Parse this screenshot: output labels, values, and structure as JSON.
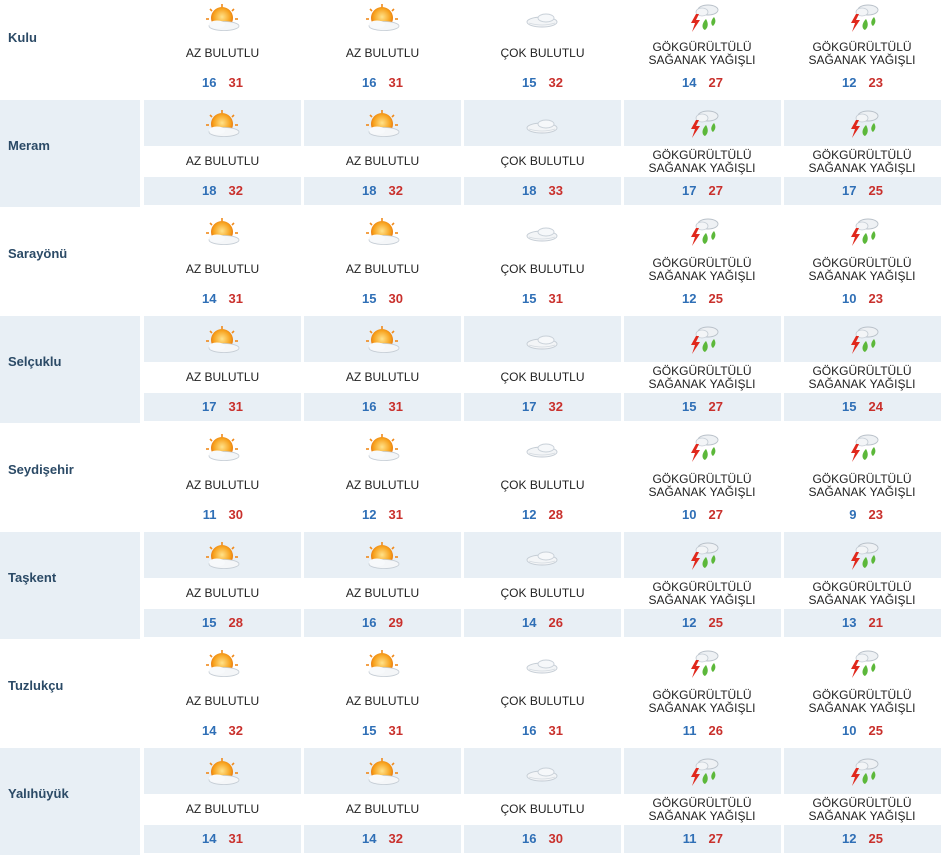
{
  "colors": {
    "shade": "#e8eff5",
    "sidebar": "#e8eff5",
    "separator": "#ffffff",
    "min_temp": "#2f6fb6",
    "max_temp": "#c9302c",
    "district_name": "#2b4a66"
  },
  "districts": [
    {
      "name": "Kulu",
      "days": [
        {
          "icon": "sun-cloud-icon",
          "condition": "AZ BULUTLU",
          "min": "16",
          "max": "31"
        },
        {
          "icon": "sun-cloud-icon",
          "condition": "AZ BULUTLU",
          "min": "16",
          "max": "31"
        },
        {
          "icon": "cloud-icon",
          "condition": "ÇOK BULUTLU",
          "min": "15",
          "max": "32"
        },
        {
          "icon": "thunderstorm-icon",
          "condition": "GÖKGÜRÜLTÜLÜ SAĞANAK YAĞIŞLI",
          "min": "14",
          "max": "27"
        },
        {
          "icon": "thunderstorm-icon",
          "condition": "GÖKGÜRÜLTÜLÜ SAĞANAK YAĞIŞLI",
          "min": "12",
          "max": "23"
        }
      ]
    },
    {
      "name": "Meram",
      "days": [
        {
          "icon": "sun-cloud-icon",
          "condition": "AZ BULUTLU",
          "min": "18",
          "max": "32"
        },
        {
          "icon": "sun-cloud-icon",
          "condition": "AZ BULUTLU",
          "min": "18",
          "max": "32"
        },
        {
          "icon": "cloud-icon",
          "condition": "ÇOK BULUTLU",
          "min": "18",
          "max": "33"
        },
        {
          "icon": "thunderstorm-icon",
          "condition": "GÖKGÜRÜLTÜLÜ SAĞANAK YAĞIŞLI",
          "min": "17",
          "max": "27"
        },
        {
          "icon": "thunderstorm-icon",
          "condition": "GÖKGÜRÜLTÜLÜ SAĞANAK YAĞIŞLI",
          "min": "17",
          "max": "25"
        }
      ]
    },
    {
      "name": "Sarayönü",
      "days": [
        {
          "icon": "sun-cloud-icon",
          "condition": "AZ BULUTLU",
          "min": "14",
          "max": "31"
        },
        {
          "icon": "sun-cloud-icon",
          "condition": "AZ BULUTLU",
          "min": "15",
          "max": "30"
        },
        {
          "icon": "cloud-icon",
          "condition": "ÇOK BULUTLU",
          "min": "15",
          "max": "31"
        },
        {
          "icon": "thunderstorm-icon",
          "condition": "GÖKGÜRÜLTÜLÜ SAĞANAK YAĞIŞLI",
          "min": "12",
          "max": "25"
        },
        {
          "icon": "thunderstorm-icon",
          "condition": "GÖKGÜRÜLTÜLÜ SAĞANAK YAĞIŞLI",
          "min": "10",
          "max": "23"
        }
      ]
    },
    {
      "name": "Selçuklu",
      "days": [
        {
          "icon": "sun-cloud-icon",
          "condition": "AZ BULUTLU",
          "min": "17",
          "max": "31"
        },
        {
          "icon": "sun-cloud-icon",
          "condition": "AZ BULUTLU",
          "min": "16",
          "max": "31"
        },
        {
          "icon": "cloud-icon",
          "condition": "ÇOK BULUTLU",
          "min": "17",
          "max": "32"
        },
        {
          "icon": "thunderstorm-icon",
          "condition": "GÖKGÜRÜLTÜLÜ SAĞANAK YAĞIŞLI",
          "min": "15",
          "max": "27"
        },
        {
          "icon": "thunderstorm-icon",
          "condition": "GÖKGÜRÜLTÜLÜ SAĞANAK YAĞIŞLI",
          "min": "15",
          "max": "24"
        }
      ]
    },
    {
      "name": "Seydişehir",
      "days": [
        {
          "icon": "sun-cloud-icon",
          "condition": "AZ BULUTLU",
          "min": "11",
          "max": "30"
        },
        {
          "icon": "sun-cloud-icon",
          "condition": "AZ BULUTLU",
          "min": "12",
          "max": "31"
        },
        {
          "icon": "cloud-icon",
          "condition": "ÇOK BULUTLU",
          "min": "12",
          "max": "28"
        },
        {
          "icon": "thunderstorm-icon",
          "condition": "GÖKGÜRÜLTÜLÜ SAĞANAK YAĞIŞLI",
          "min": "10",
          "max": "27"
        },
        {
          "icon": "thunderstorm-icon",
          "condition": "GÖKGÜRÜLTÜLÜ SAĞANAK YAĞIŞLI",
          "min": "9",
          "max": "23"
        }
      ]
    },
    {
      "name": "Taşkent",
      "days": [
        {
          "icon": "sun-cloud-icon",
          "condition": "AZ BULUTLU",
          "min": "15",
          "max": "28"
        },
        {
          "icon": "sun-cloud-icon",
          "condition": "AZ BULUTLU",
          "min": "16",
          "max": "29"
        },
        {
          "icon": "cloud-icon",
          "condition": "ÇOK BULUTLU",
          "min": "14",
          "max": "26"
        },
        {
          "icon": "thunderstorm-icon",
          "condition": "GÖKGÜRÜLTÜLÜ SAĞANAK YAĞIŞLI",
          "min": "12",
          "max": "25"
        },
        {
          "icon": "thunderstorm-icon",
          "condition": "GÖKGÜRÜLTÜLÜ SAĞANAK YAĞIŞLI",
          "min": "13",
          "max": "21"
        }
      ]
    },
    {
      "name": "Tuzlukçu",
      "days": [
        {
          "icon": "sun-cloud-icon",
          "condition": "AZ BULUTLU",
          "min": "14",
          "max": "32"
        },
        {
          "icon": "sun-cloud-icon",
          "condition": "AZ BULUTLU",
          "min": "15",
          "max": "31"
        },
        {
          "icon": "cloud-icon",
          "condition": "ÇOK BULUTLU",
          "min": "16",
          "max": "31"
        },
        {
          "icon": "thunderstorm-icon",
          "condition": "GÖKGÜRÜLTÜLÜ SAĞANAK YAĞIŞLI",
          "min": "11",
          "max": "26"
        },
        {
          "icon": "thunderstorm-icon",
          "condition": "GÖKGÜRÜLTÜLÜ SAĞANAK YAĞIŞLI",
          "min": "10",
          "max": "25"
        }
      ]
    },
    {
      "name": "Yalıhüyük",
      "days": [
        {
          "icon": "sun-cloud-icon",
          "condition": "AZ BULUTLU",
          "min": "14",
          "max": "31"
        },
        {
          "icon": "sun-cloud-icon",
          "condition": "AZ BULUTLU",
          "min": "14",
          "max": "32"
        },
        {
          "icon": "cloud-icon",
          "condition": "ÇOK BULUTLU",
          "min": "16",
          "max": "30"
        },
        {
          "icon": "thunderstorm-icon",
          "condition": "GÖKGÜRÜLTÜLÜ SAĞANAK YAĞIŞLI",
          "min": "11",
          "max": "27"
        },
        {
          "icon": "thunderstorm-icon",
          "condition": "GÖKGÜRÜLTÜLÜ SAĞANAK YAĞIŞLI",
          "min": "12",
          "max": "25"
        }
      ]
    }
  ]
}
